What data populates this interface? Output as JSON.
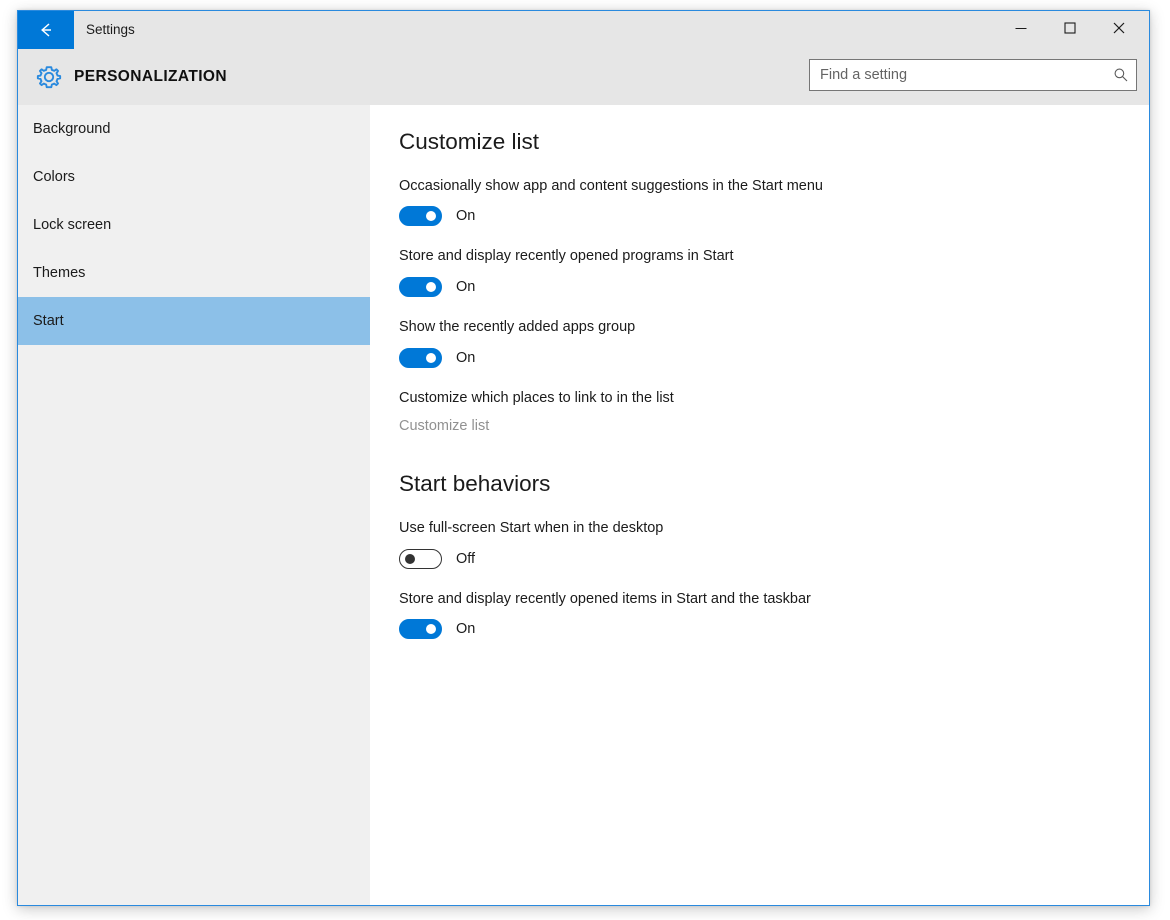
{
  "window": {
    "title": "Settings",
    "back_icon": "back-arrow-icon",
    "minimize_label": "‒",
    "maximize_label": "□",
    "close_label": "✕"
  },
  "header": {
    "icon": "gear-icon",
    "category": "PERSONALIZATION",
    "accent_color": "#0078d7"
  },
  "search": {
    "placeholder": "Find a setting",
    "value": "",
    "icon": "search-icon"
  },
  "sidebar": {
    "items": [
      {
        "label": "Background",
        "selected": false
      },
      {
        "label": "Colors",
        "selected": false
      },
      {
        "label": "Lock screen",
        "selected": false
      },
      {
        "label": "Themes",
        "selected": false
      },
      {
        "label": "Start",
        "selected": true
      }
    ],
    "selected_color": "#8cc0e8",
    "background_color": "#f0f0f0"
  },
  "main": {
    "sections": [
      {
        "title": "Customize list",
        "settings": [
          {
            "label": "Occasionally show app and content suggestions in the Start menu",
            "state": "On",
            "on": true
          },
          {
            "label": "Store and display recently opened programs in Start",
            "state": "On",
            "on": true
          },
          {
            "label": "Show the recently added apps group",
            "state": "On",
            "on": true
          }
        ],
        "link_block": {
          "label": "Customize which places to link to in the list",
          "link": "Customize list"
        }
      },
      {
        "title": "Start behaviors",
        "settings": [
          {
            "label": "Use full-screen Start when in the desktop",
            "state": "Off",
            "on": false
          },
          {
            "label": "Store and display recently opened items in Start and the taskbar",
            "state": "On",
            "on": true
          }
        ]
      }
    ]
  }
}
